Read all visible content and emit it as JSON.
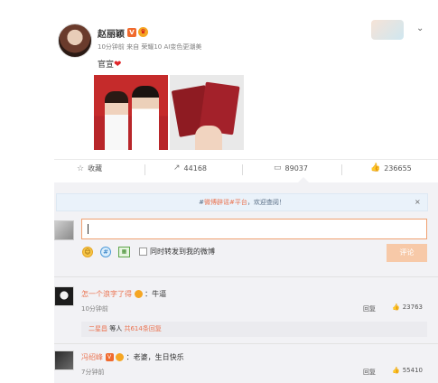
{
  "post": {
    "username": "赵丽颖",
    "vip_badge": "V",
    "meta": "10分钟前 来自 荣耀10 AI变色更潮美",
    "text": "官宣",
    "heart": "❤"
  },
  "actions": {
    "favorite": "收藏",
    "repost": "44168",
    "comment": "89037",
    "like": "236655"
  },
  "notice": {
    "prefix": "#",
    "highlight": "微博辟谣#平台",
    "suffix": "，欢迎查阅！",
    "close": "×"
  },
  "composer": {
    "emoji_icon": "☺",
    "hashtag_icon": "#",
    "image_icon": "▦",
    "repost_checkbox_label": "同时转发到我的微博",
    "submit_label": "评论"
  },
  "comments": [
    {
      "name": "怎一个浪字了得",
      "text": "：牛逼",
      "time": "10分钟前",
      "reply_label": "回复",
      "likes": "23763"
    },
    {
      "name": "冯绍峰",
      "text": "：老婆，生日快乐",
      "time": "7分钟前",
      "reply_label": "回复",
      "likes": "55410"
    }
  ],
  "subreply": {
    "name": "二星昌",
    "text": "等人",
    "count": "共614条回复"
  },
  "icons": {
    "star": "☆",
    "repost": "↗",
    "comment": "▭",
    "thumb": "👍",
    "chevron": "⌄"
  },
  "colors": {
    "accent": "#eb7350",
    "panel_bg": "#f2f2f5",
    "notice_bg": "#eaf2fa"
  }
}
